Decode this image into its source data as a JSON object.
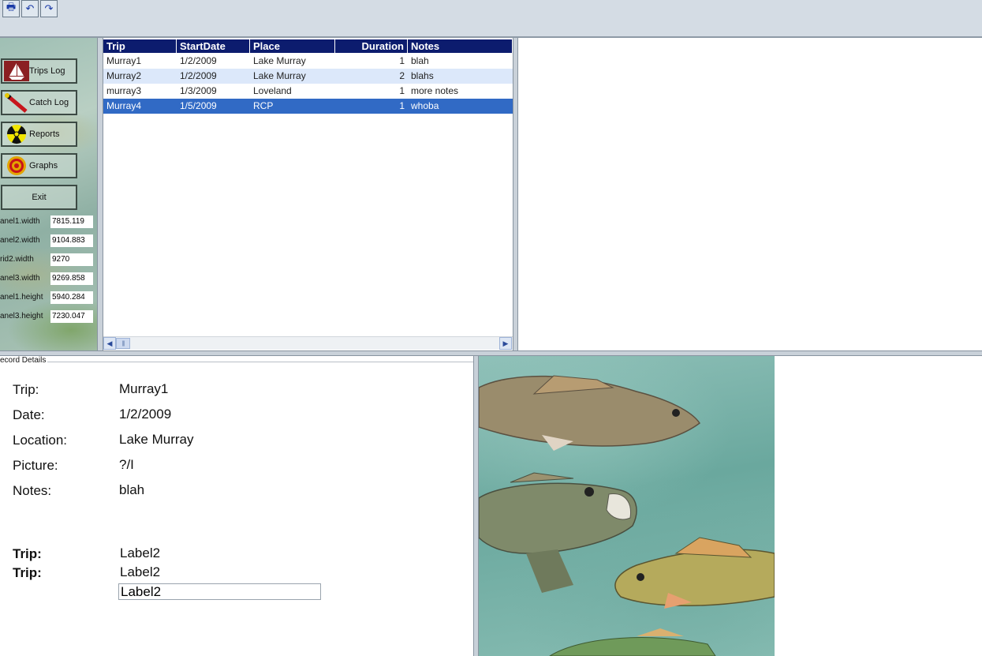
{
  "toolbar": {
    "buttons": [
      {
        "name": "print-icon",
        "glyph": "🖶"
      },
      {
        "name": "undo-icon",
        "glyph": "↶"
      },
      {
        "name": "redo-icon",
        "glyph": "↷"
      }
    ]
  },
  "nav": {
    "buttons": [
      {
        "label": "Trips Log",
        "icon": "sailboat-icon"
      },
      {
        "label": "Catch Log",
        "icon": "fishing-rod-icon"
      },
      {
        "label": "Reports",
        "icon": "radiation-icon"
      },
      {
        "label": "Graphs",
        "icon": "target-icon"
      },
      {
        "label": "Exit",
        "icon": ""
      }
    ]
  },
  "props": [
    {
      "label": "anel1.width",
      "value": "7815.119"
    },
    {
      "label": "anel2.width",
      "value": "9104.883"
    },
    {
      "label": "rid2.width",
      "value": "9270"
    },
    {
      "label": "anel3.width",
      "value": "9269.858"
    },
    {
      "label": "anel1.height",
      "value": "5940.284"
    },
    {
      "label": "anel3.height",
      "value": "7230.047"
    }
  ],
  "grid": {
    "columns": [
      "Trip",
      "StartDate",
      "Place",
      "Duration",
      "Notes"
    ],
    "rows": [
      [
        "Murray1",
        "1/2/2009",
        "Lake Murray",
        "1",
        "blah"
      ],
      [
        "Murray2",
        "1/2/2009",
        "Lake Murray",
        "2",
        "blahs"
      ],
      [
        "murray3",
        "1/3/2009",
        "Loveland",
        "1",
        "more notes"
      ],
      [
        "Murray4",
        "1/5/2009",
        "RCP",
        "1",
        "whoba"
      ]
    ],
    "selected_row": 3,
    "alt_row_color": "#dce8fa",
    "selected_color": "#316ac5"
  },
  "details": {
    "frame_label": "ecord Details",
    "fields": [
      {
        "label": "Trip:",
        "value": "Murray1"
      },
      {
        "label": "Date:",
        "value": "1/2/2009"
      },
      {
        "label": "Location:",
        "value": "Lake Murray"
      },
      {
        "label": "Picture:",
        "value": "?/Ι"
      },
      {
        "label": "Notes:",
        "value": "blah"
      }
    ],
    "extra1_label": "Trip:",
    "extra1_value": "Label2",
    "extra2_label": "Trip:",
    "extra2_value": "Label2",
    "textbox_value": "Label2"
  }
}
